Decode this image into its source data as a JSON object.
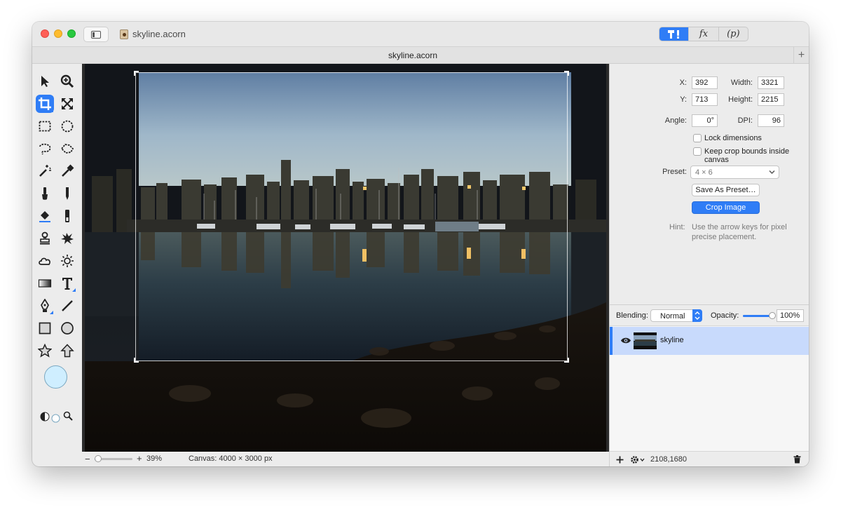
{
  "window": {
    "title": "skyline.acorn",
    "tab_title": "skyline.acorn",
    "tab_add": "+"
  },
  "mode_tabs": [
    {
      "label": "",
      "icon": "tools-icon",
      "active": true
    },
    {
      "label": "fx",
      "icon": "",
      "active": false
    },
    {
      "label": "(p)",
      "icon": "",
      "active": false
    }
  ],
  "crop": {
    "x_label": "X:",
    "x": "392",
    "width_label": "Width:",
    "width": "3321",
    "y_label": "Y:",
    "y": "713",
    "height_label": "Height:",
    "height": "2215",
    "angle_label": "Angle:",
    "angle": "0°",
    "dpi_label": "DPI:",
    "dpi": "96",
    "lock_dimensions": "Lock dimensions",
    "keep_bounds": "Keep crop bounds inside canvas",
    "preset_label": "Preset:",
    "preset_value": "4 × 6",
    "save_preset": "Save As Preset…",
    "crop_image": "Crop Image",
    "hint_label": "Hint:",
    "hint_text_1": "Use the arrow keys for pixel",
    "hint_text_2": "precise placement."
  },
  "layers": {
    "blending_label": "Blending:",
    "blending_value": "Normal",
    "opacity_label": "Opacity:",
    "opacity_value": "100%",
    "opacity_level": 1.0,
    "items": [
      {
        "name": "skyline",
        "visible": true,
        "selected": true
      }
    ],
    "coords": "2108,1680"
  },
  "status": {
    "zoom_minus": "−",
    "zoom_plus": "+",
    "zoom": "39%",
    "zoom_level": 0.1,
    "canvas_size": "Canvas: 4000 × 3000 px"
  },
  "colors": {
    "accent": "#2f7df6",
    "foreground_swatch": "#cfeeff"
  }
}
